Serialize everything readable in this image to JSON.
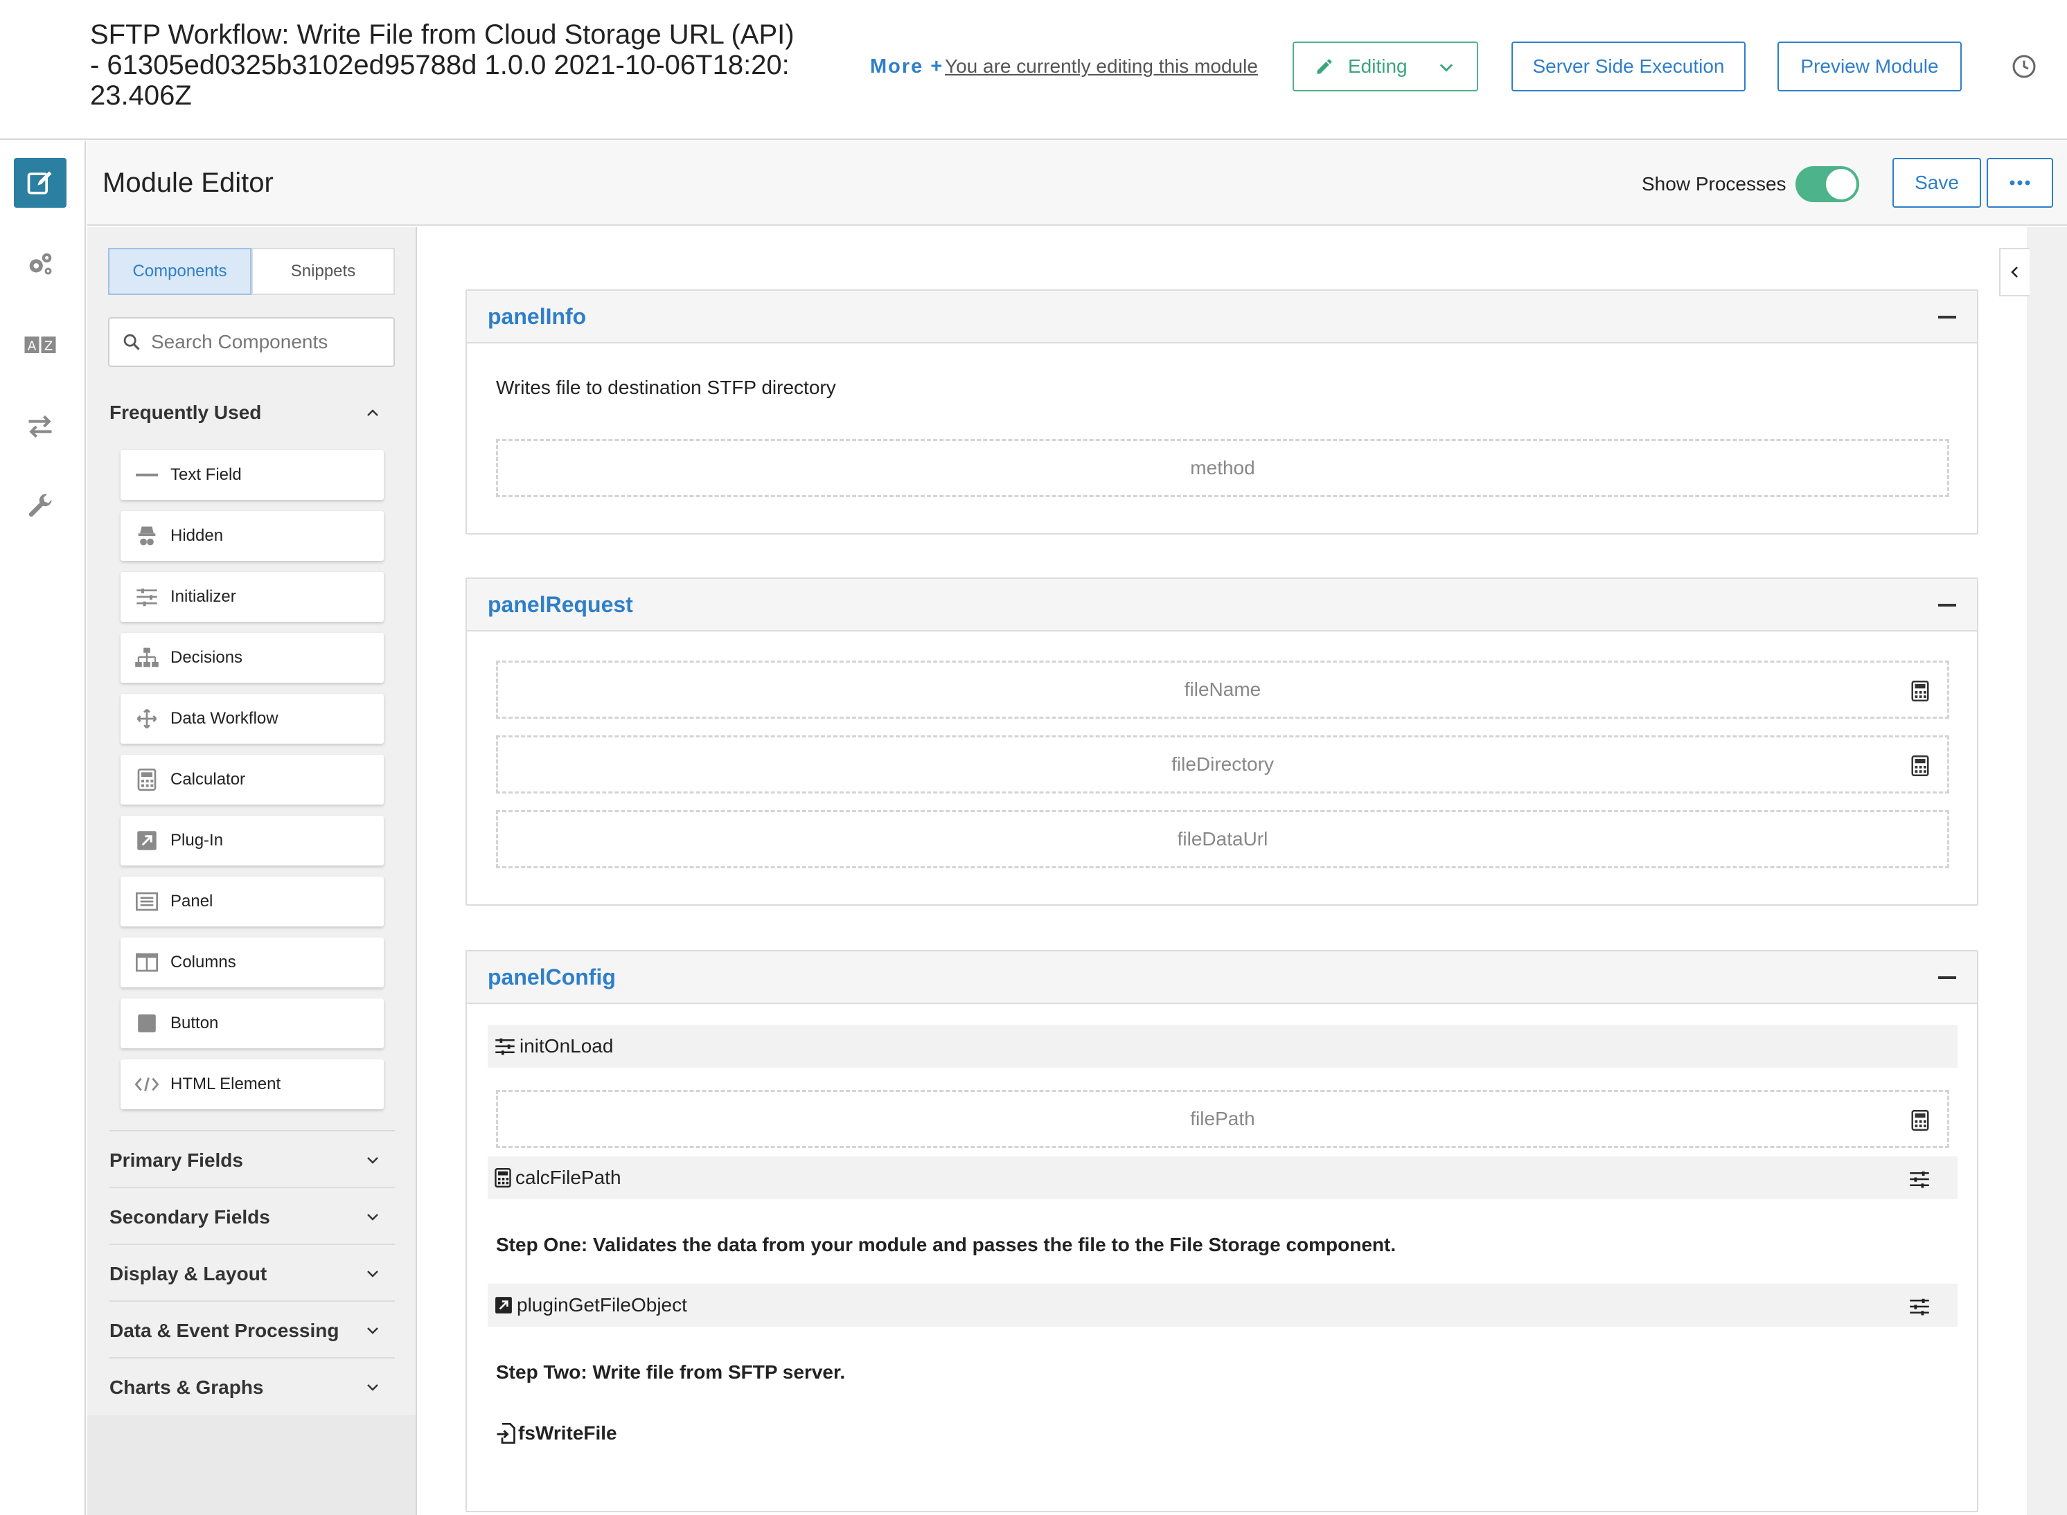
{
  "header": {
    "title": "SFTP Workflow: Write File from Cloud Storage URL (API) - 61305ed0325b3102ed95788d 1.0.0 2021-10-06T18:20:23.406Z",
    "more_label": "More +",
    "editing_notice": "You are currently editing this module",
    "editing_label": "Editing",
    "server_side_label": "Server Side Execution",
    "preview_label": "Preview Module"
  },
  "editor": {
    "title": "Module Editor",
    "show_processes_label": "Show Processes",
    "show_processes_on": true,
    "save_label": "Save"
  },
  "sidebar": {
    "tabs": [
      {
        "label": "Components",
        "active": true
      },
      {
        "label": "Snippets",
        "active": false
      }
    ],
    "search_placeholder": "Search Components",
    "frequently_used_label": "Frequently Used",
    "items": [
      {
        "label": "Text Field",
        "icon": "text-field-icon"
      },
      {
        "label": "Hidden",
        "icon": "hidden-icon"
      },
      {
        "label": "Initializer",
        "icon": "initializer-icon"
      },
      {
        "label": "Decisions",
        "icon": "decisions-icon"
      },
      {
        "label": "Data Workflow",
        "icon": "data-workflow-icon"
      },
      {
        "label": "Calculator",
        "icon": "calculator-icon"
      },
      {
        "label": "Plug-In",
        "icon": "plugin-icon"
      },
      {
        "label": "Panel",
        "icon": "panel-icon"
      },
      {
        "label": "Columns",
        "icon": "columns-icon"
      },
      {
        "label": "Button",
        "icon": "button-icon"
      },
      {
        "label": "HTML Element",
        "icon": "html-element-icon"
      }
    ],
    "groups": [
      {
        "label": "Primary Fields"
      },
      {
        "label": "Secondary Fields"
      },
      {
        "label": "Display & Layout"
      },
      {
        "label": "Data & Event Processing"
      },
      {
        "label": "Charts & Graphs"
      }
    ]
  },
  "canvas": {
    "panel_info": {
      "title": "panelInfo",
      "description": "Writes file to destination STFP directory",
      "fields": [
        "method"
      ]
    },
    "panel_request": {
      "title": "panelRequest",
      "fields": [
        "fileName",
        "fileDirectory",
        "fileDataUrl"
      ]
    },
    "panel_config": {
      "title": "panelConfig",
      "init_on_load": "initOnLoad",
      "file_path": "filePath",
      "calc_file_path": "calcFilePath",
      "step_one": "Step One: Validates the data from your module and passes the file to the File Storage component.",
      "plugin_get_file_object": "pluginGetFileObject",
      "step_two": "Step Two: Write file from SFTP server.",
      "fs_write_file": "fsWriteFile"
    }
  },
  "colors": {
    "accent": "#2f7fc9",
    "success": "#4db38a",
    "rail_active": "#2b7fa0"
  }
}
